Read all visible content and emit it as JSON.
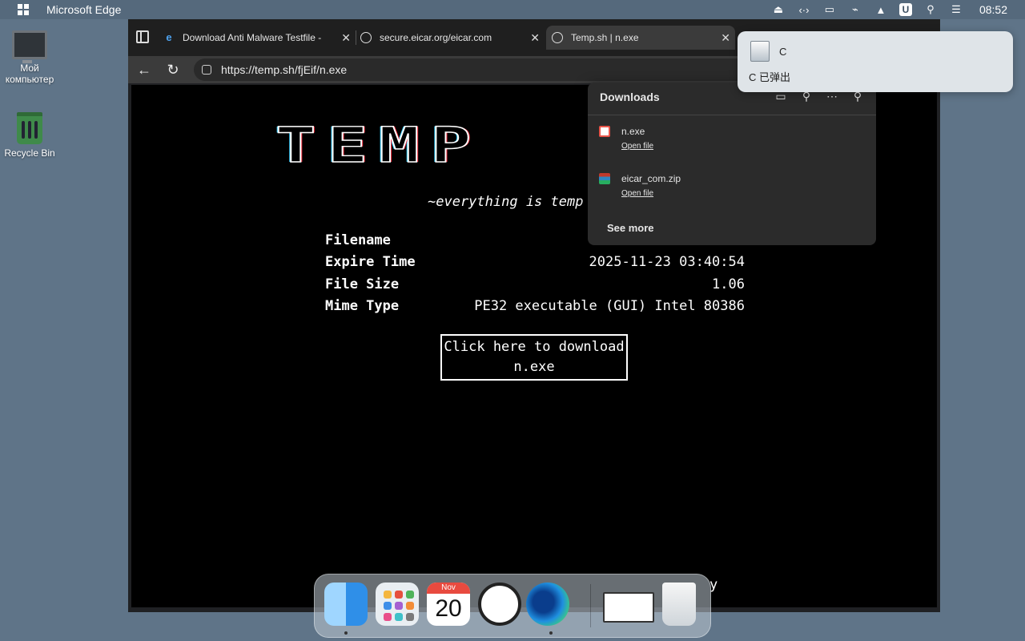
{
  "menubar": {
    "app_name": "Microsoft Edge",
    "time": "08:52",
    "status_icons": [
      "eject-icon",
      "code-icon",
      "display-icon",
      "wifi-off-icon",
      "upload-icon",
      "u-icon",
      "search-icon",
      "control-center-icon"
    ]
  },
  "desktop": {
    "my_computer_label": "Мой компьютер",
    "recycle_bin_label": "Recycle Bin"
  },
  "browser": {
    "tabs": [
      {
        "title": "Download Anti Malware Testfile -",
        "icon": "edge-icon",
        "active": false
      },
      {
        "title": "secure.eicar.org/eicar.com",
        "icon": "globe-icon",
        "active": false
      },
      {
        "title": "Temp.sh | n.exe",
        "icon": "globe-icon",
        "active": true
      }
    ],
    "url": "https://temp.sh/fjEif/n.exe"
  },
  "page": {
    "logo": "TEMP",
    "tagline": "~everything is temp",
    "info": [
      {
        "key": "Filename",
        "value": ""
      },
      {
        "key": "Expire Time",
        "value": "2025-11-23 03:40:54"
      },
      {
        "key": "File Size",
        "value": "1.06"
      },
      {
        "key": "Mime Type",
        "value": "PE32 executable (GUI) Intel 80386"
      }
    ],
    "download_line1": "Click here to download",
    "download_line2": "n.exe",
    "footer_fragment": "y"
  },
  "downloads": {
    "title": "Downloads",
    "items": [
      {
        "name": "n.exe",
        "action": "Open file"
      },
      {
        "name": "eicar_com.zip",
        "action": "Open file"
      }
    ],
    "see_more": "See more"
  },
  "notification": {
    "drive_label": "C",
    "message": "C 已弹出"
  },
  "dock": {
    "calendar_month": "Nov",
    "calendar_day": "20"
  }
}
